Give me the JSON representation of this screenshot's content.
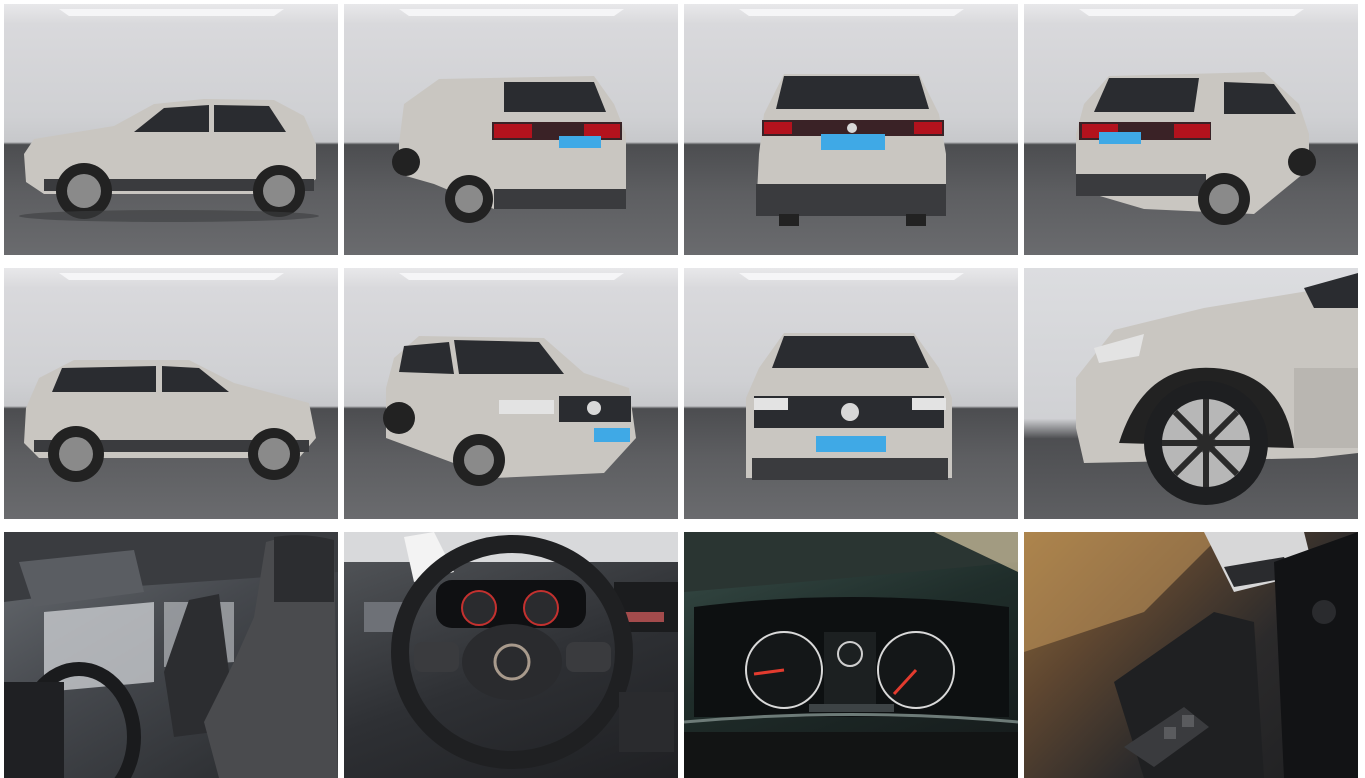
{
  "gallery": {
    "tiles": [
      {
        "view": "side-left",
        "icon": "car-side-left-photo"
      },
      {
        "view": "rear-left-three-quarter",
        "icon": "car-rear-three-quarter-photo"
      },
      {
        "view": "rear",
        "icon": "car-rear-photo"
      },
      {
        "view": "rear-right-three-quarter",
        "icon": "car-rear-three-quarter-right-photo"
      },
      {
        "view": "side-right",
        "icon": "car-side-right-photo"
      },
      {
        "view": "front-left-three-quarter",
        "icon": "car-front-three-quarter-photo"
      },
      {
        "view": "front",
        "icon": "car-front-photo"
      },
      {
        "view": "front-wheel-detail",
        "icon": "car-wheel-detail-photo"
      },
      {
        "view": "interior-front-seats",
        "icon": "car-seats-photo"
      },
      {
        "view": "steering-wheel",
        "icon": "steering-wheel-photo"
      },
      {
        "view": "instrument-cluster",
        "icon": "instrument-cluster-photo"
      },
      {
        "view": "door-panel",
        "icon": "door-panel-photo"
      }
    ]
  },
  "colors": {
    "car_body": "#c9c6c1",
    "studio_wall": "#d4d5d8",
    "studio_floor": "#555659",
    "plate": "#3fa9e6",
    "taillight": "#b3121d"
  }
}
